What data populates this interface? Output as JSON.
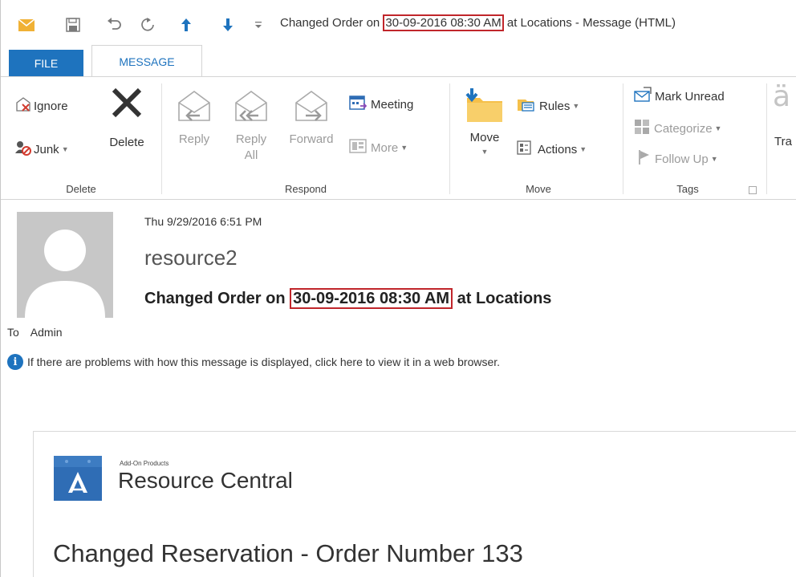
{
  "window": {
    "title_prefix": "Changed Order on ",
    "title_highlight": "30-09-2016 08:30 AM",
    "title_suffix": "at Locations - Message (HTML)"
  },
  "tabs": [
    {
      "label": "FILE"
    },
    {
      "label": "MESSAGE"
    }
  ],
  "ribbon": {
    "delete_group": {
      "label": "Delete",
      "ignore": "Ignore",
      "junk": "Junk",
      "delete": "Delete"
    },
    "respond_group": {
      "label": "Respond",
      "reply": "Reply",
      "reply_all_line1": "Reply",
      "reply_all_line2": "All",
      "forward": "Forward",
      "meeting": "Meeting",
      "more": "More"
    },
    "move_group": {
      "label": "Move",
      "move": "Move",
      "rules": "Rules",
      "actions": "Actions"
    },
    "tags_group": {
      "label": "Tags",
      "mark_unread": "Mark Unread",
      "categorize": "Categorize",
      "follow_up": "Follow Up"
    },
    "partial_group": {
      "label": "Tra"
    }
  },
  "message": {
    "date": "Thu 9/29/2016 6:51 PM",
    "sender": "resource2",
    "subject_prefix": "Changed Order on ",
    "subject_highlight": "30-09-2016 08:30 AM",
    "subject_suffix": "at Locations",
    "to_label": "To",
    "to_value": "Admin",
    "info_text": "If there are problems with how this message is displayed, click here to view it in a web browser."
  },
  "email_body": {
    "brand_small": "Add-On Products",
    "brand_name": "Resource Central",
    "heading": "Changed Reservation - Order Number 133"
  },
  "colors": {
    "accent_blue": "#1e73be",
    "highlight_red": "#c0262b",
    "envelope_yellow": "#f0b135",
    "folder_yellow": "#f5c04a",
    "brand_blue": "#2f6db5"
  }
}
